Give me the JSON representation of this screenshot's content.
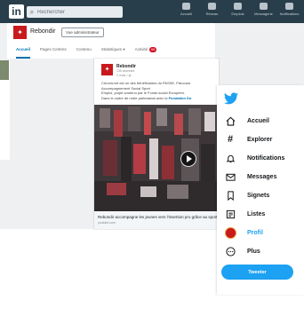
{
  "linkedin": {
    "logo": "in",
    "search": {
      "placeholder": "Rechercher",
      "icon": "search-icon"
    },
    "nav": [
      {
        "label": "Accueil",
        "icon": "home-icon"
      },
      {
        "label": "Réseau",
        "icon": "network-icon"
      },
      {
        "label": "Emplois",
        "icon": "jobs-icon"
      },
      {
        "label": "Messagerie",
        "icon": "messaging-icon"
      },
      {
        "label": "Notifications",
        "icon": "bell-icon"
      }
    ],
    "company": {
      "name": "Rebondir",
      "admin_button": "Vue administrateur",
      "tabs": [
        "Accueil",
        "Pages Centres",
        "Contenu",
        "Statistiques ▾",
        "Activité"
      ],
      "activity_badge": "99"
    },
    "post": {
      "author": "Rebondir",
      "followers": "135 abonnés",
      "time": "2 mois • ◍",
      "text_line1": "Chronic'art est un des bénéficiaires du PASSE, Parcours Accompagnement Social Sport",
      "text_line2": "Emploi, projet soutenu par le Fonds social Européen.",
      "text_line3_prefix": "Dans le cadre de notre partenariat avec la ",
      "text_line3_link": "Fondation Do",
      "caption_title": "Rebondir accompagne les jeunes vers l'insertion pro grâce au sport",
      "caption_domain": "youtube.com"
    }
  },
  "twitter": {
    "logo_icon": "twitter-bird-icon",
    "brand_color": "#1da1f2",
    "nav": [
      {
        "label": "Accueil",
        "icon": "home-outline-icon"
      },
      {
        "label": "Explorer",
        "icon": "hashtag-icon"
      },
      {
        "label": "Notifications",
        "icon": "bell-outline-icon"
      },
      {
        "label": "Messages",
        "icon": "envelope-icon"
      },
      {
        "label": "Signets",
        "icon": "bookmark-icon"
      },
      {
        "label": "Listes",
        "icon": "list-icon"
      },
      {
        "label": "Profil",
        "icon": "avatar"
      },
      {
        "label": "Plus",
        "icon": "more-circle-icon"
      }
    ],
    "tweet_button": "Tweeter"
  }
}
